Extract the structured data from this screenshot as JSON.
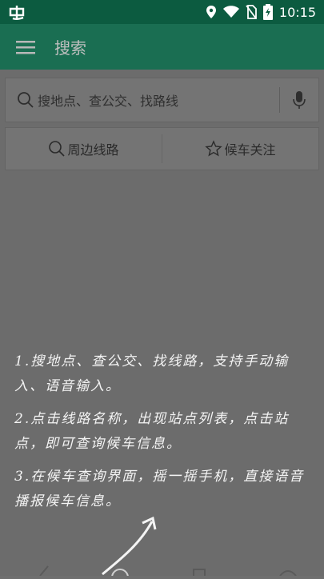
{
  "status_bar": {
    "app_icon": "app-logo",
    "time": "10:15",
    "icons": [
      "location-icon",
      "wifi-icon",
      "no-sim-icon",
      "battery-charging-icon"
    ]
  },
  "app_bar": {
    "menu_icon": "hamburger-menu-icon",
    "title": "搜索"
  },
  "search": {
    "placeholder": "搜地点、查公交、找路线",
    "search_icon": "search-icon",
    "mic_icon": "microphone-icon"
  },
  "quick_actions": [
    {
      "label": "周边线路",
      "icon": "search-icon"
    },
    {
      "label": "候车关注",
      "icon": "star-icon"
    }
  ],
  "guide": {
    "lines": [
      "1.搜地点、查公交、找线路，支持手动输入、语音输入。",
      "2.点击线路名称，出现站点列表，点击站点，即可查询候车信息。",
      "3.在候车查询界面，摇一摇手机，直接语音播报候车信息。"
    ]
  },
  "colors": {
    "status_bar": "#0c5b40",
    "app_bar": "#1a6e52",
    "overlay_bg": "#6c6c6c",
    "guide_text": "#f4f4f4"
  }
}
